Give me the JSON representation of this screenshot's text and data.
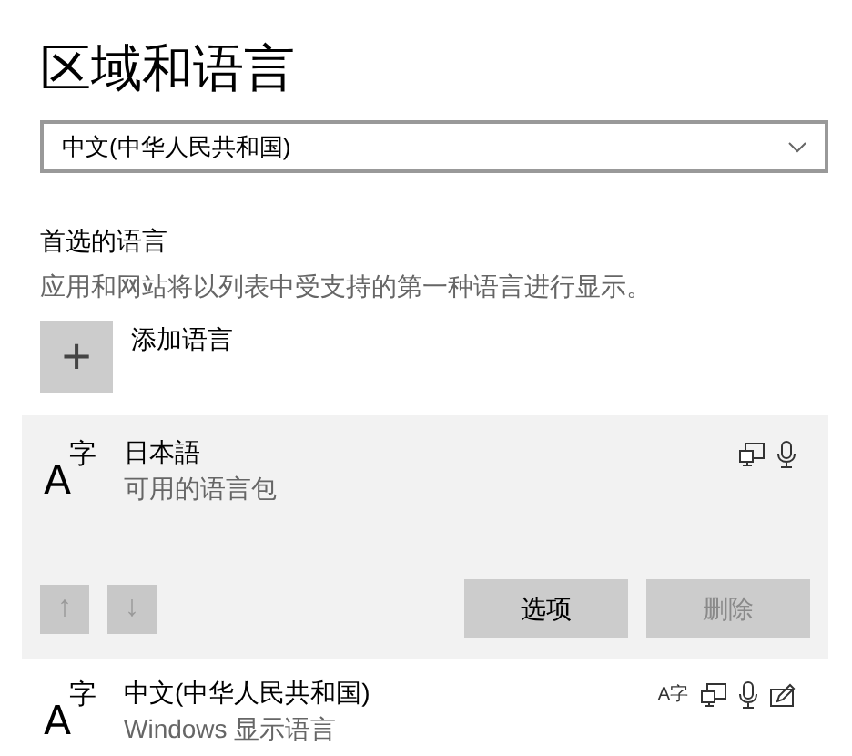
{
  "page_title": "区域和语言",
  "region_dropdown": {
    "value": "中文(中华人民共和国)"
  },
  "preferred_languages": {
    "heading": "首选的语言",
    "description": "应用和网站将以列表中受支持的第一种语言进行显示。",
    "add_button": {
      "icon": "+",
      "label": "添加语言"
    },
    "languages": [
      {
        "glyph_base": "A",
        "glyph_raised": "字",
        "name": "日本語",
        "status": "可用的语言包",
        "selected": true,
        "features": [
          {
            "kind": "display"
          },
          {
            "kind": "speech"
          }
        ],
        "actions": {
          "move_up": {
            "icon": "↑",
            "disabled": true
          },
          "move_down": {
            "icon": "↓",
            "disabled": true
          },
          "buttons": [
            {
              "label": "选项",
              "disabled": false
            },
            {
              "label": "删除",
              "disabled": true
            }
          ]
        }
      },
      {
        "glyph_base": "A",
        "glyph_raised": "字",
        "name": "中文(中华人民共和国)",
        "status": "Windows 显示语言",
        "selected": false,
        "features": [
          {
            "kind": "language_pack",
            "text": "A字"
          },
          {
            "kind": "display"
          },
          {
            "kind": "speech"
          },
          {
            "kind": "handwriting"
          }
        ]
      }
    ]
  }
}
